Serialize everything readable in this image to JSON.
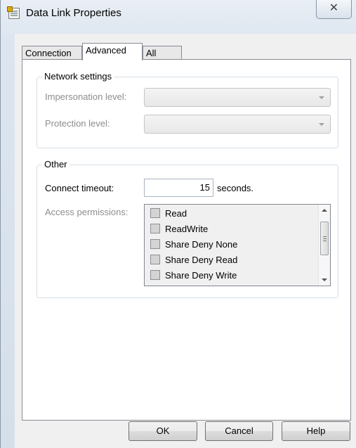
{
  "window": {
    "title": "Data Link Properties",
    "close_glyph": "✕"
  },
  "tabs": [
    {
      "label": "Connection"
    },
    {
      "label": "Advanced"
    },
    {
      "label": "All"
    }
  ],
  "network_settings": {
    "legend": "Network settings",
    "impersonation_label": "Impersonation level:",
    "impersonation_value": "",
    "protection_label": "Protection level:",
    "protection_value": ""
  },
  "other": {
    "legend": "Other",
    "timeout_label": "Connect timeout:",
    "timeout_value": "15",
    "timeout_unit": "seconds.",
    "permissions_label": "Access permissions:",
    "permissions": [
      {
        "label": "Read",
        "checked": false
      },
      {
        "label": "ReadWrite",
        "checked": false
      },
      {
        "label": "Share Deny None",
        "checked": false
      },
      {
        "label": "Share Deny Read",
        "checked": false
      },
      {
        "label": "Share Deny Write",
        "checked": false
      }
    ]
  },
  "buttons": {
    "ok": "OK",
    "cancel": "Cancel",
    "help": "Help"
  },
  "icons": {
    "app": "data-link-app-icon",
    "close": "close-icon",
    "combo_arrow": "chevron-down-icon",
    "scroll_up": "scroll-up-icon",
    "scroll_down": "scroll-down-icon"
  }
}
